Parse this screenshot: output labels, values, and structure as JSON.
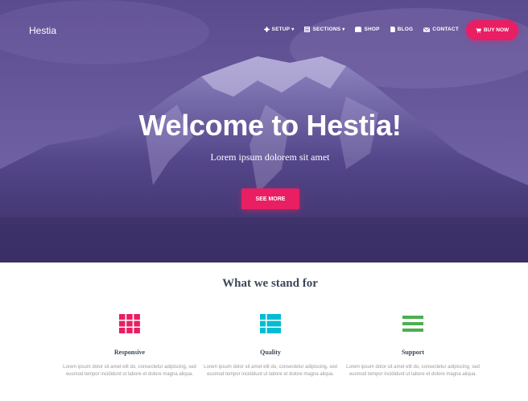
{
  "nav": {
    "brand": "Hestia",
    "items": [
      {
        "label": "SETUP",
        "icon": "gear-icon",
        "dropdown": true
      },
      {
        "label": "SECTIONS",
        "icon": "sections-icon",
        "dropdown": true
      },
      {
        "label": "SHOP",
        "icon": "shop-icon",
        "dropdown": false
      },
      {
        "label": "BLOG",
        "icon": "blog-icon",
        "dropdown": false
      },
      {
        "label": "CONTACT",
        "icon": "mail-icon",
        "dropdown": false
      }
    ],
    "buy_label": "BUY NOW",
    "caret": "▾"
  },
  "hero": {
    "title": "Welcome to Hestia!",
    "subtitle": "Lorem ipsum dolorem sit amet",
    "button": "SEE MORE"
  },
  "section": {
    "title": "What we stand for"
  },
  "features": [
    {
      "title": "Responsive",
      "icon": "grid-icon",
      "color": "#e91e63",
      "text": "Lorem ipsum dolor sit amet elit do, consectetur adipiscing, sed eusmod tempor incididunt ut labore et dolore magna aliqua."
    },
    {
      "title": "Quality",
      "icon": "list-icon",
      "color": "#00bcd4",
      "text": "Lorem ipsum dolor sit amet elit do, consectetur adipiscing, sed eusmod tempor incididunt ut labore et dolore magna aliqua."
    },
    {
      "title": "Support",
      "icon": "menu-icon",
      "color": "#4caf50",
      "text": "Lorem ipsum dolor sit amet elit do, consectetur adipiscing, sed eusmod tempor incididunt ut labore et dolore magna aliqua."
    }
  ],
  "colors": {
    "accent": "#e91e63",
    "hero_tint": "#5b4a8f",
    "heading": "#3c4858",
    "body_text": "#999999"
  }
}
